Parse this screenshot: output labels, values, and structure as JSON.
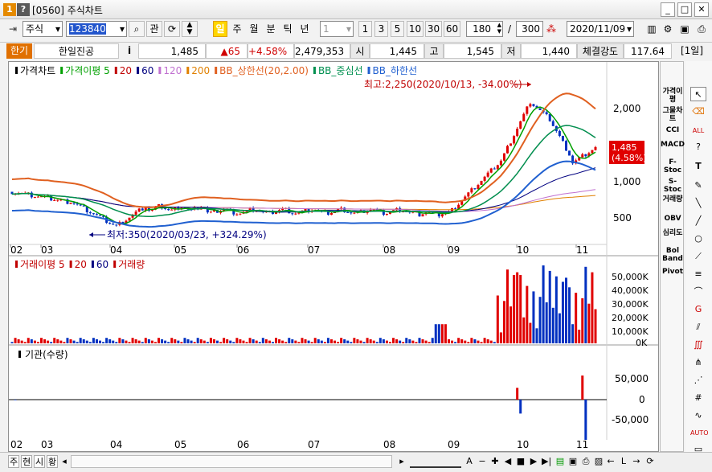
{
  "window": {
    "title": "[0560] 주식차트",
    "icon1": "1",
    "icon2": "?"
  },
  "toolbar": {
    "market": "주식",
    "code": "123840",
    "btn_gwan": "관",
    "periods": [
      "일",
      "주",
      "월",
      "분",
      "틱",
      "년"
    ],
    "interval": "1",
    "nums": [
      "1",
      "3",
      "5",
      "10",
      "30",
      "60"
    ],
    "count": "180",
    "count_total": "300",
    "date": "2020/11/09"
  },
  "quote": {
    "tab": "한기",
    "name": "한일진공",
    "info": "i",
    "price": "1,485",
    "change": "▲65",
    "pct": "+4.58%",
    "volume": "2,479,353",
    "open_label": "시",
    "open": "1,445",
    "high_label": "고",
    "high": "1,545",
    "low_label": "저",
    "low": "1,440",
    "strength_label": "체결강도",
    "strength": "117.64",
    "period": "[1일]"
  },
  "legend_price": [
    {
      "text": "가격차트",
      "color": "#000000"
    },
    {
      "text": "가격이평 5",
      "color": "#00a000"
    },
    {
      "text": "20",
      "color": "#c00000"
    },
    {
      "text": "60",
      "color": "#000080"
    },
    {
      "text": "120",
      "color": "#c070d0"
    },
    {
      "text": "200",
      "color": "#e08000"
    },
    {
      "text": "BB_상한선(20,2.00)",
      "color": "#e06020"
    },
    {
      "text": "BB_중심선",
      "color": "#009050"
    },
    {
      "text": "BB_하한선",
      "color": "#2060d0"
    }
  ],
  "legend_vol": [
    {
      "text": "거래이평 5",
      "color": "#c00000"
    },
    {
      "text": "20",
      "color": "#c00000"
    },
    {
      "text": "60",
      "color": "#000080"
    },
    {
      "text": "거래량",
      "color": "#c00000"
    }
  ],
  "legend_inst": {
    "text": "기관(수량)",
    "color": "#000000"
  },
  "annotations": {
    "high": "최고:2,250(2020/10/13, -34.00%)",
    "low": "최저:350(2020/03/23, +324.29%)"
  },
  "price_tag": {
    "value": "1,485",
    "pct": "(4.58%)"
  },
  "y_price": [
    "2,000",
    "1,500",
    "1,000",
    "500"
  ],
  "y_vol": [
    "50,000K",
    "40,000K",
    "30,000K",
    "20,000K",
    "10,000K",
    "0K"
  ],
  "y_inst": [
    "50,000",
    "0",
    "-50,000"
  ],
  "x_labels": [
    "02",
    "03",
    "04",
    "05",
    "06",
    "07",
    "08",
    "09",
    "10",
    "11"
  ],
  "right_panel": [
    "가격이평",
    "그물차트",
    "CCI",
    "MACD",
    "F-Stoc",
    "S-Stoc",
    "거래량",
    "OBV",
    "심리도",
    "Bol Band",
    "Pivot"
  ],
  "bottom": {
    "tabs": [
      "주",
      "현",
      "시",
      "황"
    ]
  },
  "chart_data": {
    "type": "candlestick",
    "series": [
      {
        "name": "가격차트",
        "type": "candlestick"
      },
      {
        "name": "거래량",
        "type": "bar"
      },
      {
        "name": "기관(수량)",
        "type": "bar"
      }
    ],
    "annotations": [
      {
        "label": "최고",
        "value": 2250,
        "date": "2020/10/13",
        "pct": "-34.00%"
      },
      {
        "label": "최저",
        "value": 350,
        "date": "2020/03/23",
        "pct": "+324.29%"
      }
    ],
    "last": {
      "value": 1485,
      "pct": "4.58%"
    }
  }
}
